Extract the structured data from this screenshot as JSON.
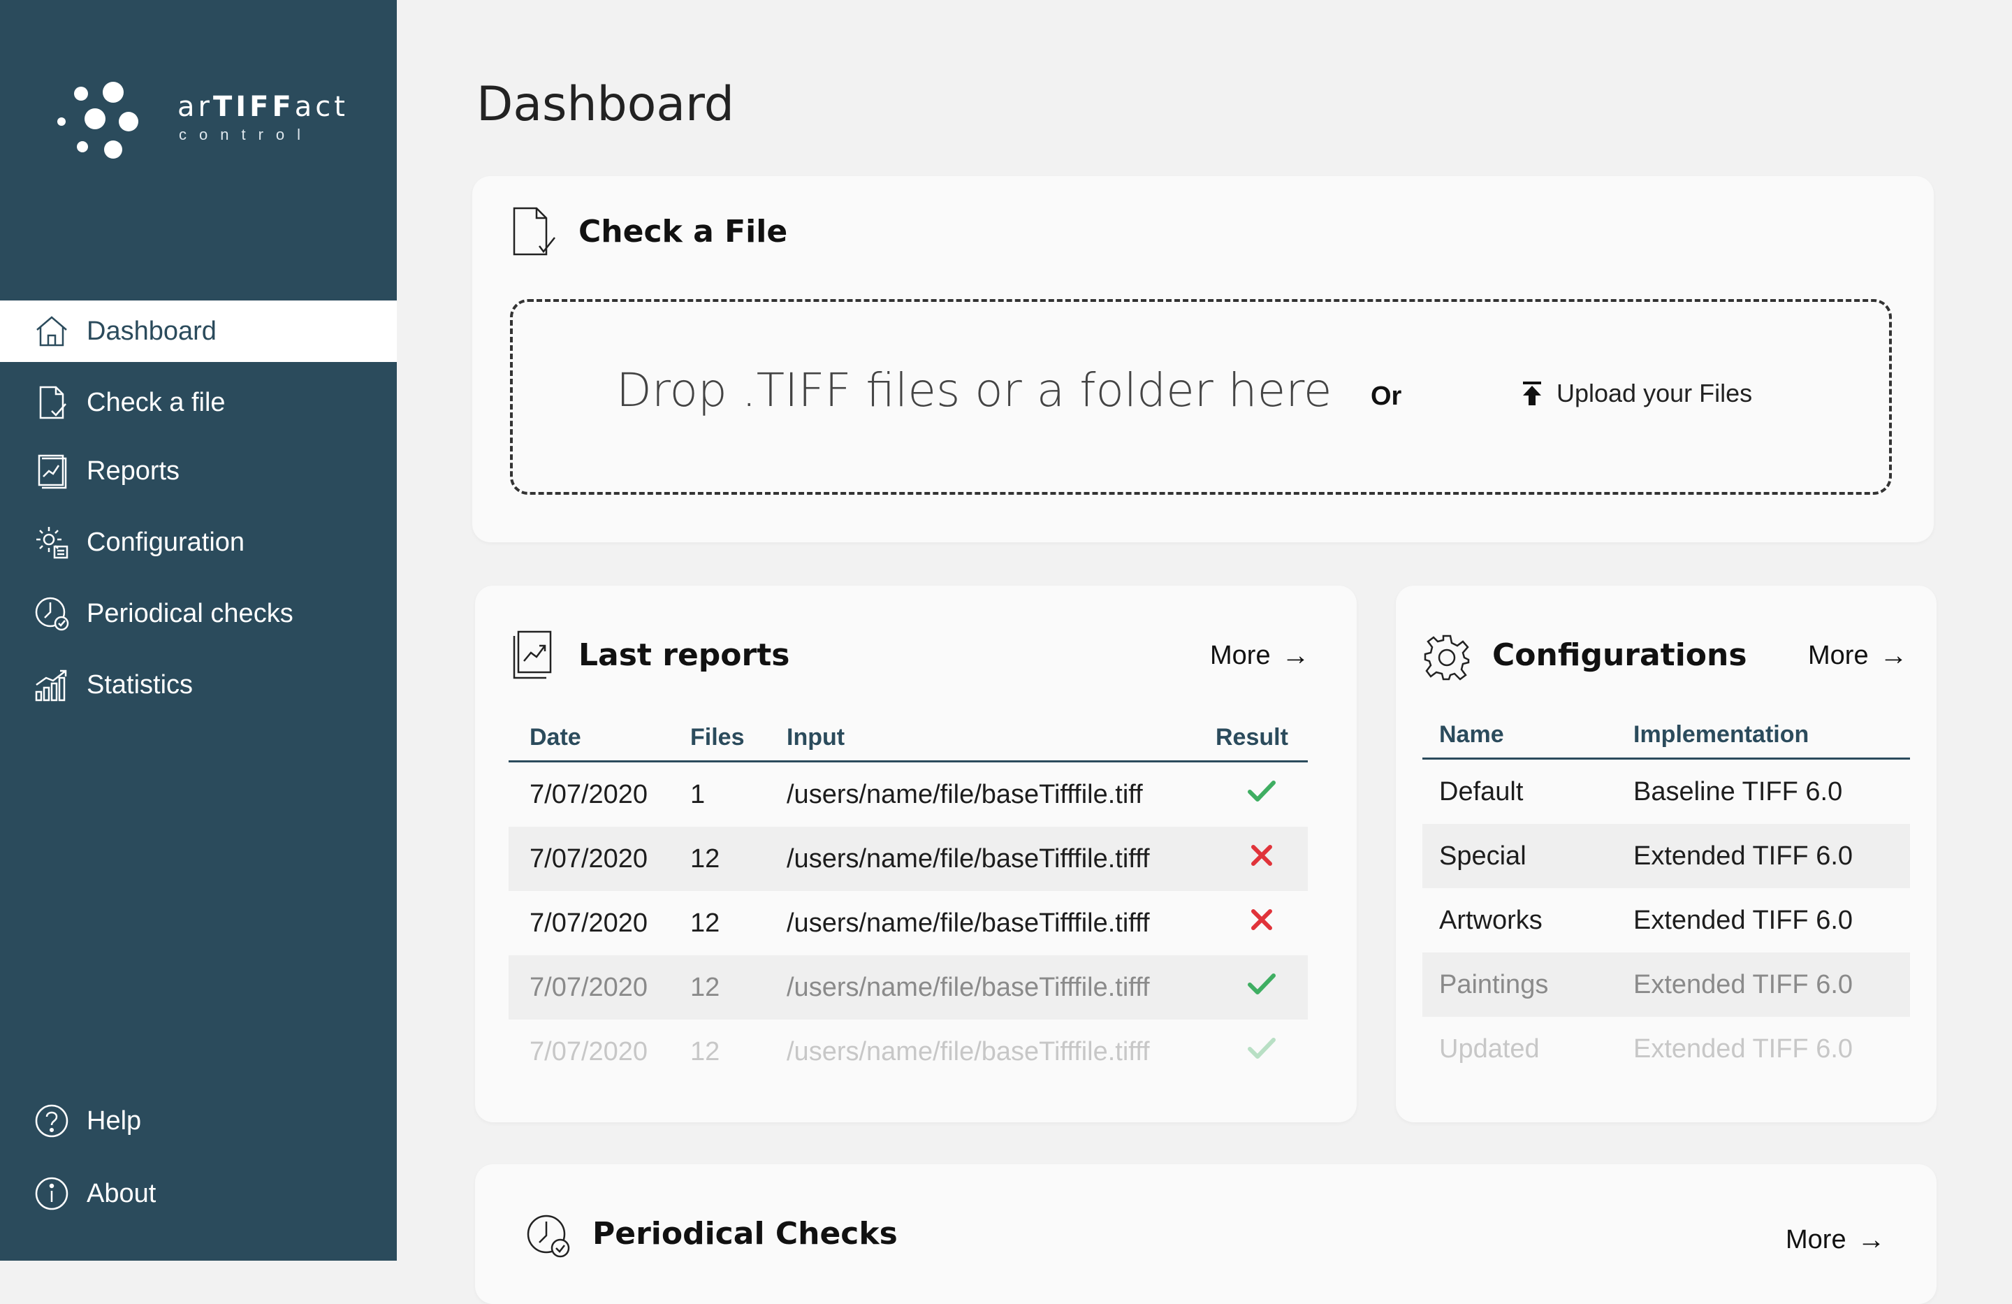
{
  "brand": {
    "name_prefix": "ar",
    "name_bold": "TIFF",
    "name_suffix": "act",
    "subtitle": "control"
  },
  "nav": {
    "items": [
      {
        "label": "Dashboard",
        "icon": "home-icon",
        "active": true
      },
      {
        "label": "Check a file",
        "icon": "file-check-icon"
      },
      {
        "label": "Reports",
        "icon": "report-icon"
      },
      {
        "label": "Configuration",
        "icon": "gear-doc-icon"
      },
      {
        "label": "Periodical checks",
        "icon": "clock-check-icon"
      },
      {
        "label": "Statistics",
        "icon": "chart-icon"
      }
    ],
    "bottom": [
      {
        "label": "Help",
        "icon": "help-icon"
      },
      {
        "label": "About",
        "icon": "info-icon"
      }
    ]
  },
  "page": {
    "title": "Dashboard"
  },
  "check_file": {
    "title": "Check a File",
    "drop_text": "Drop .TIFF files or a folder here",
    "or": "Or",
    "upload": "Upload your Files"
  },
  "last_reports": {
    "title": "Last reports",
    "more": "More",
    "columns": [
      "Date",
      "Files",
      "Input",
      "Result"
    ],
    "rows": [
      {
        "date": "7/07/2020",
        "files": "1",
        "input": "/users/name/file/baseTifffile.tiff",
        "result": "pass"
      },
      {
        "date": "7/07/2020",
        "files": "12",
        "input": "/users/name/file/baseTifffile.tifff",
        "result": "fail"
      },
      {
        "date": "7/07/2020",
        "files": "12",
        "input": "/users/name/file/baseTifffile.tifff",
        "result": "fail"
      },
      {
        "date": "7/07/2020",
        "files": "12",
        "input": "/users/name/file/baseTifffile.tifff",
        "result": "pass"
      },
      {
        "date": "7/07/2020",
        "files": "12",
        "input": "/users/name/file/baseTifffile.tifff",
        "result": "pass"
      }
    ]
  },
  "configurations": {
    "title": "Configurations",
    "more": "More",
    "columns": [
      "Name",
      "Implementation"
    ],
    "rows": [
      {
        "name": "Default",
        "implementation": "Baseline TIFF 6.0"
      },
      {
        "name": "Special",
        "implementation": "Extended TIFF 6.0"
      },
      {
        "name": "Artworks",
        "implementation": "Extended TIFF 6.0"
      },
      {
        "name": "Paintings",
        "implementation": "Extended TIFF 6.0"
      },
      {
        "name": "Updated",
        "implementation": "Extended TIFF 6.0"
      }
    ]
  },
  "periodical": {
    "title": "Periodical Checks",
    "more": "More"
  },
  "colors": {
    "sidebar": "#2b4b5c",
    "pass": "#3fae62",
    "fail": "#e0333a",
    "background": "#f2f2f2"
  }
}
